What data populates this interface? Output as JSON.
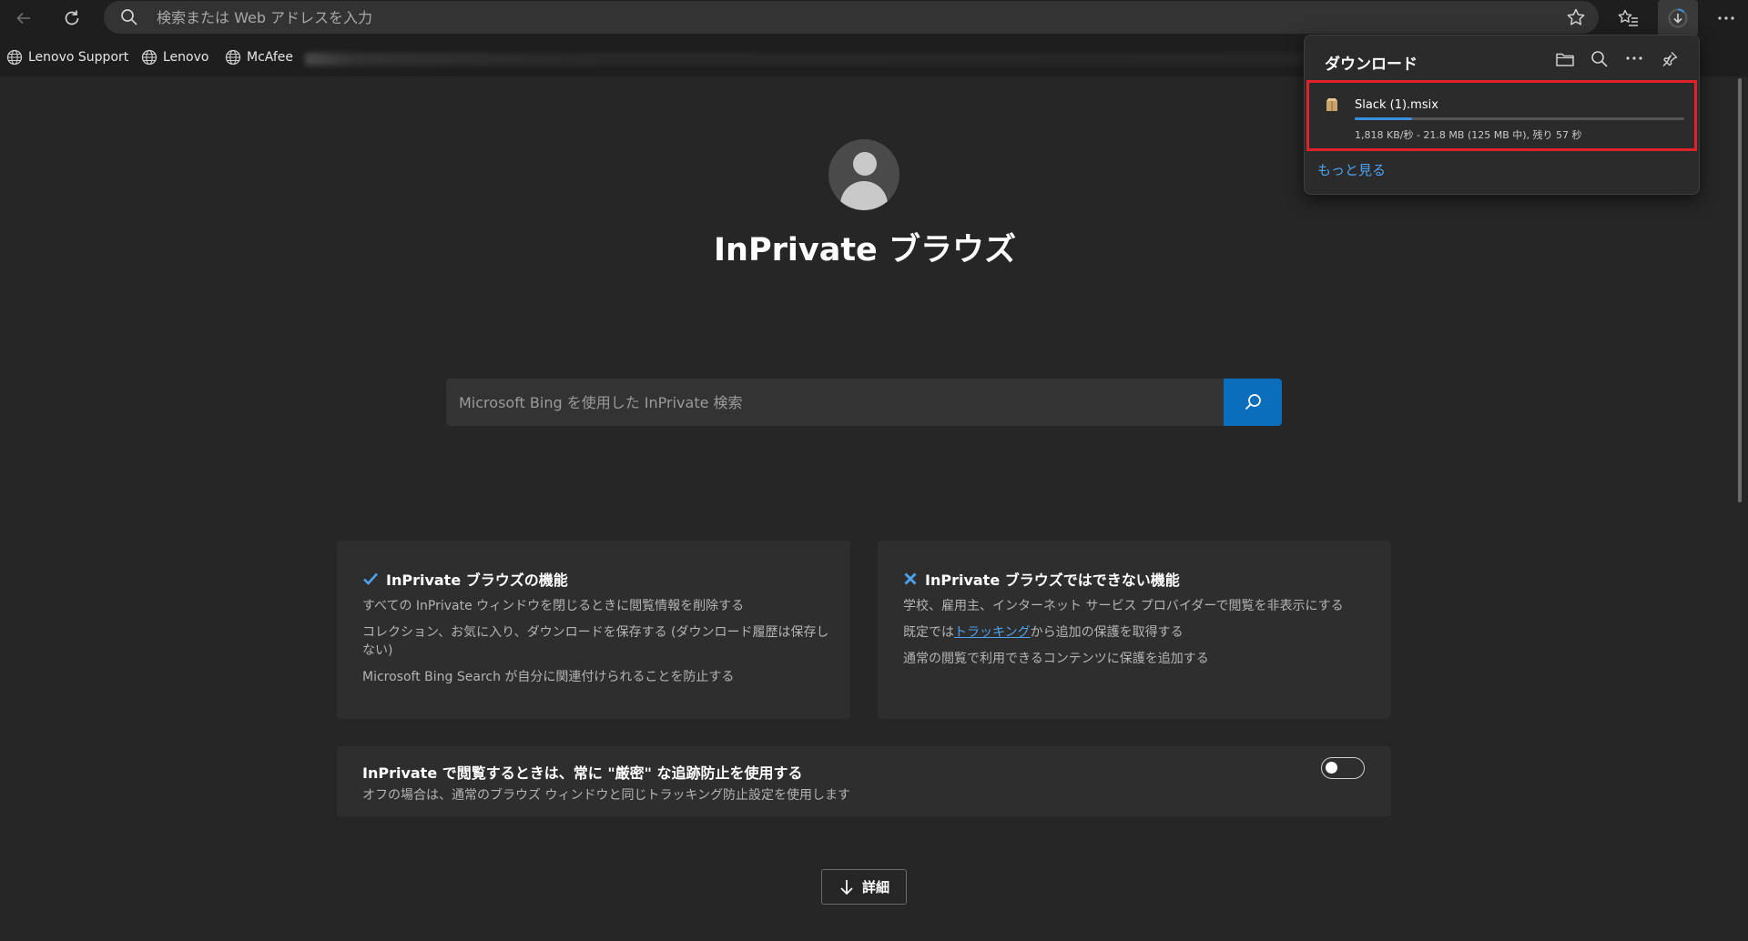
{
  "toolbar": {
    "address_placeholder": "検索または Web アドレスを入力"
  },
  "favorites": [
    {
      "label": "Lenovo Support"
    },
    {
      "label": "Lenovo"
    },
    {
      "label": "McAfee"
    }
  ],
  "main": {
    "title": "InPrivate ブラウズ",
    "search_placeholder": "Microsoft Bing を使用した InPrivate 検索",
    "features_card": {
      "title": "InPrivate ブラウズの機能",
      "lines": [
        "すべての InPrivate ウィンドウを閉じるときに閲覧情報を削除する",
        "コレクション、お気に入り、ダウンロードを保存する (ダウンロード履歴は保存しない)",
        "Microsoft Bing Search が自分に関連付けられることを防止する"
      ]
    },
    "limits_card": {
      "title": "InPrivate ブラウズではできない機能",
      "line1": "学校、雇用主、インターネット サービス プロバイダーで閲覧を非表示にする",
      "line2_prefix": "既定では",
      "line2_link": "トラッキング",
      "line2_suffix": "から追加の保護を取得する",
      "line3": "通常の閲覧で利用できるコンテンツに保護を追加する"
    },
    "strict_tracking": {
      "title": "InPrivate で閲覧するときは、常に \"厳密\" な追跡防止を使用する",
      "subtitle": "オフの場合は、通常のブラウズ ウィンドウと同じトラッキング防止設定を使用します",
      "enabled": false
    },
    "details_button": "詳細"
  },
  "downloads": {
    "title": "ダウンロード",
    "item": {
      "filename": "Slack (1).msix",
      "status": "1,818 KB/秒 - 21.8 MB (125 MB 中), 残り 57 秒",
      "progress_fraction": 0.174
    },
    "more_link": "もっと見る"
  },
  "colors": {
    "accent": "#0a6ebd",
    "link": "#4ea3f1",
    "highlight_border": "#e0232b",
    "page_bg": "#262626",
    "card_bg": "#2e2e2e"
  }
}
